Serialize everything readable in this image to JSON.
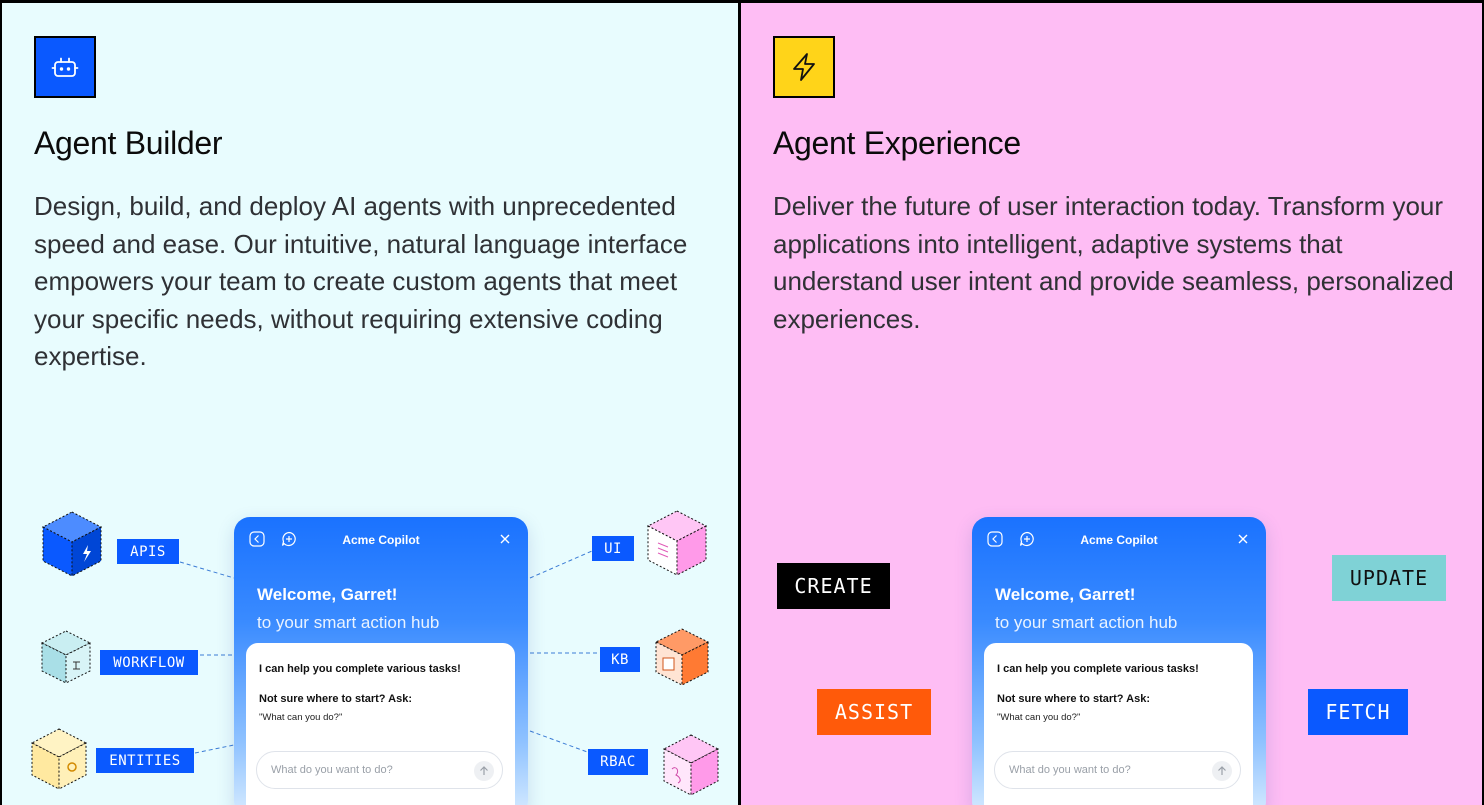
{
  "builder": {
    "title": "Agent Builder",
    "description": "Design, build, and deploy AI agents with unprecedented speed and ease. Our intuitive, natural language interface empowers your team to create custom agents that meet your specific needs, without requiring extensive coding expertise.",
    "icon": "robot-icon",
    "accent": "#0a59ff",
    "tags": {
      "apis": "APIS",
      "workflow": "WORKFLOW",
      "entities": "ENTITIES",
      "ui": "UI",
      "kb": "KB",
      "rbac": "RBAC"
    }
  },
  "experience": {
    "title": "Agent Experience",
    "description": "Deliver the future of user interaction today. Transform your applications into intelligent, adaptive systems that understand user intent and provide seamless, personalized experiences.",
    "icon": "lightning-icon",
    "accent": "#ffd419",
    "tags": {
      "create": "CREATE",
      "update": "UPDATE",
      "assist": "ASSIST",
      "fetch": "FETCH"
    }
  },
  "copilot": {
    "title": "Acme Copilot",
    "welcome": "Welcome, Garret!",
    "subtitle": "to your smart action hub",
    "intro": "I can help you complete various tasks!",
    "prompt_heading": "Not sure where to start? Ask:",
    "example": "\"What can you do?\"",
    "input_placeholder": "What do you want to do?"
  }
}
